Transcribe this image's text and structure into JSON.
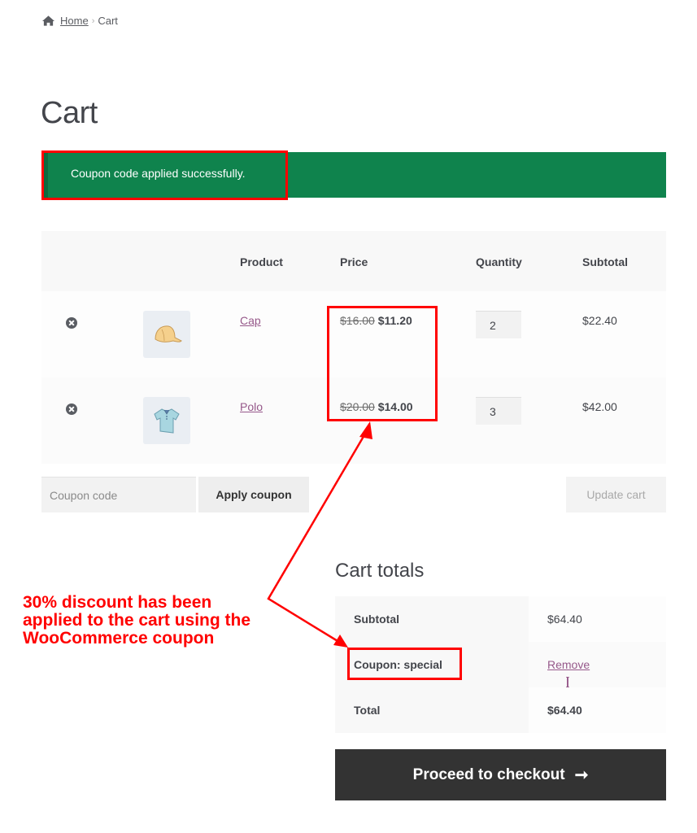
{
  "breadcrumb": {
    "icon": "home-icon",
    "home": "Home",
    "separator": "›",
    "current": "Cart"
  },
  "page_title": "Cart",
  "notice": {
    "message": "Coupon code applied successfully.",
    "color": "#0f834d"
  },
  "cart_table": {
    "headers": [
      "",
      "",
      "Product",
      "Price",
      "Quantity",
      "Subtotal"
    ],
    "rows": [
      {
        "remove_icon": "remove-circle-icon",
        "thumbnail": "cap-image",
        "product": "Cap",
        "regular_price": "$16.00",
        "sale_price": "$11.20",
        "quantity": "2",
        "subtotal": "$22.40"
      },
      {
        "remove_icon": "remove-circle-icon",
        "thumbnail": "polo-image",
        "product": "Polo",
        "regular_price": "$20.00",
        "sale_price": "$14.00",
        "quantity": "3",
        "subtotal": "$42.00"
      }
    ]
  },
  "actions": {
    "coupon_placeholder": "Coupon code",
    "coupon_value": "",
    "apply_coupon": "Apply coupon",
    "update_cart": "Update cart"
  },
  "cart_totals": {
    "title": "Cart totals",
    "rows": [
      {
        "label": "Subtotal",
        "value": "$64.40"
      },
      {
        "label": "Coupon: special",
        "value_prefix": "[",
        "link": "Remove",
        "value_suffix": "]"
      },
      {
        "label": "Total",
        "value": "$64.40"
      }
    ],
    "checkout_button": "Proceed to checkout",
    "checkout_arrow": "➞"
  },
  "annotation": {
    "lines": [
      "30% discount has been",
      "applied to the cart using the",
      "WooCommerce coupon"
    ],
    "color": "#ff0000"
  },
  "colors": {
    "link": "#96588a",
    "dark_button": "#333333",
    "text": "#43454b"
  }
}
